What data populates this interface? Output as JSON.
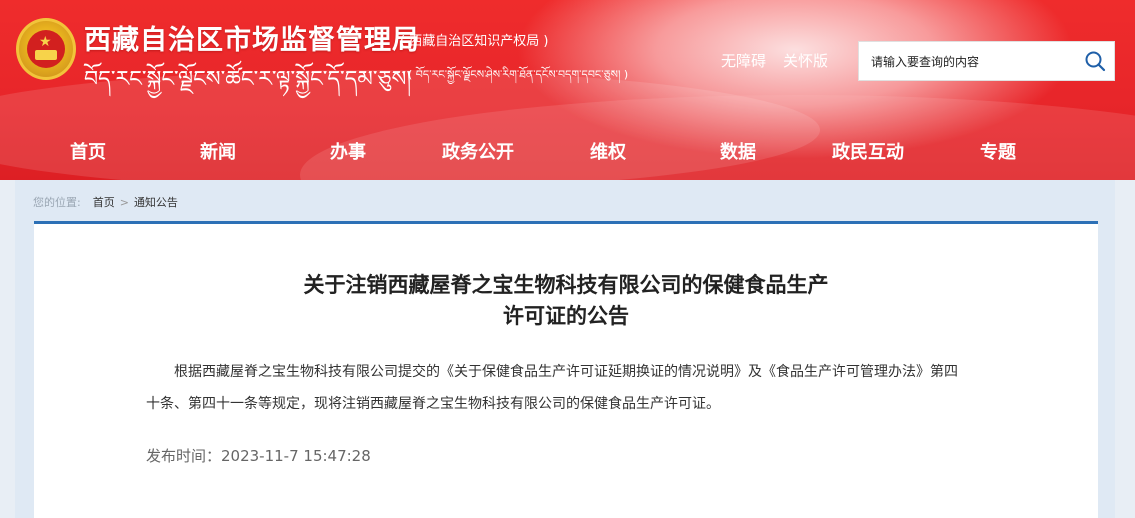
{
  "header": {
    "site_title": "西藏自治区市场监督管理局",
    "site_subtitle": "( 西藏自治区知识产权局 )",
    "tibetan_title": "བོད་རང་སྐྱོང་ལྗོངས་ཚོང་ར་ལྟ་སྐྱོང་དོ་དམ་ཅུས།",
    "tibetan_subtitle": "( བོད་རང་སྐྱོང་ལྗོངས་ཤེས་རིག་ཐོན་དངོས་བདག་དབང་ཅུས། )",
    "links": [
      "无障碍",
      "关怀版"
    ],
    "search_placeholder": "请输入要查询的内容"
  },
  "nav": {
    "items": [
      "首页",
      "新闻",
      "办事",
      "政务公开",
      "维权",
      "数据",
      "政民互动",
      "专题"
    ]
  },
  "breadcrumb": {
    "label": "您的位置:",
    "items": [
      "首页",
      "通知公告"
    ],
    "separator": ">"
  },
  "article": {
    "title_line1": "关于注销西藏屋脊之宝生物科技有限公司的保健食品生产",
    "title_line2": "许可证的公告",
    "body": "根据西藏屋脊之宝生物科技有限公司提交的《关于保健食品生产许可证延期换证的情况说明》及《食品生产许可管理办法》第四十条、第四十一条等规定，现将注销西藏屋脊之宝生物科技有限公司的保健食品生产许可证。",
    "publish_time": "发布时间：2023-11-7 15:47:28"
  },
  "colors": {
    "banner_red": "#e8262a",
    "accent_blue": "#2c70b6",
    "content_bg": "#dfe9f4"
  }
}
